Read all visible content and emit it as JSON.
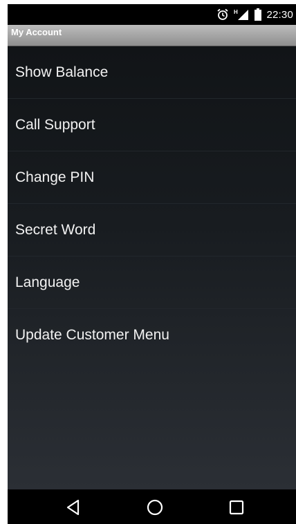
{
  "status_bar": {
    "time": "22:30",
    "icons": [
      "alarm-icon",
      "signal-icon",
      "battery-icon"
    ],
    "network_label": "H"
  },
  "title_bar": {
    "title": "My Account"
  },
  "menu": {
    "items": [
      {
        "label": "Show Balance"
      },
      {
        "label": "Call Support"
      },
      {
        "label": "Change PIN"
      },
      {
        "label": "Secret Word"
      },
      {
        "label": "Language"
      },
      {
        "label": "Update Customer Menu"
      }
    ]
  },
  "nav_bar": {
    "buttons": [
      "back-icon",
      "home-icon",
      "recents-icon"
    ]
  },
  "colors": {
    "title_bar_top": "#bdbdbd",
    "title_bar_bottom": "#8e8e8e",
    "menu_background_top": "#111417",
    "menu_background_bottom": "#2b2f35",
    "menu_text": "#f2f2f2"
  }
}
